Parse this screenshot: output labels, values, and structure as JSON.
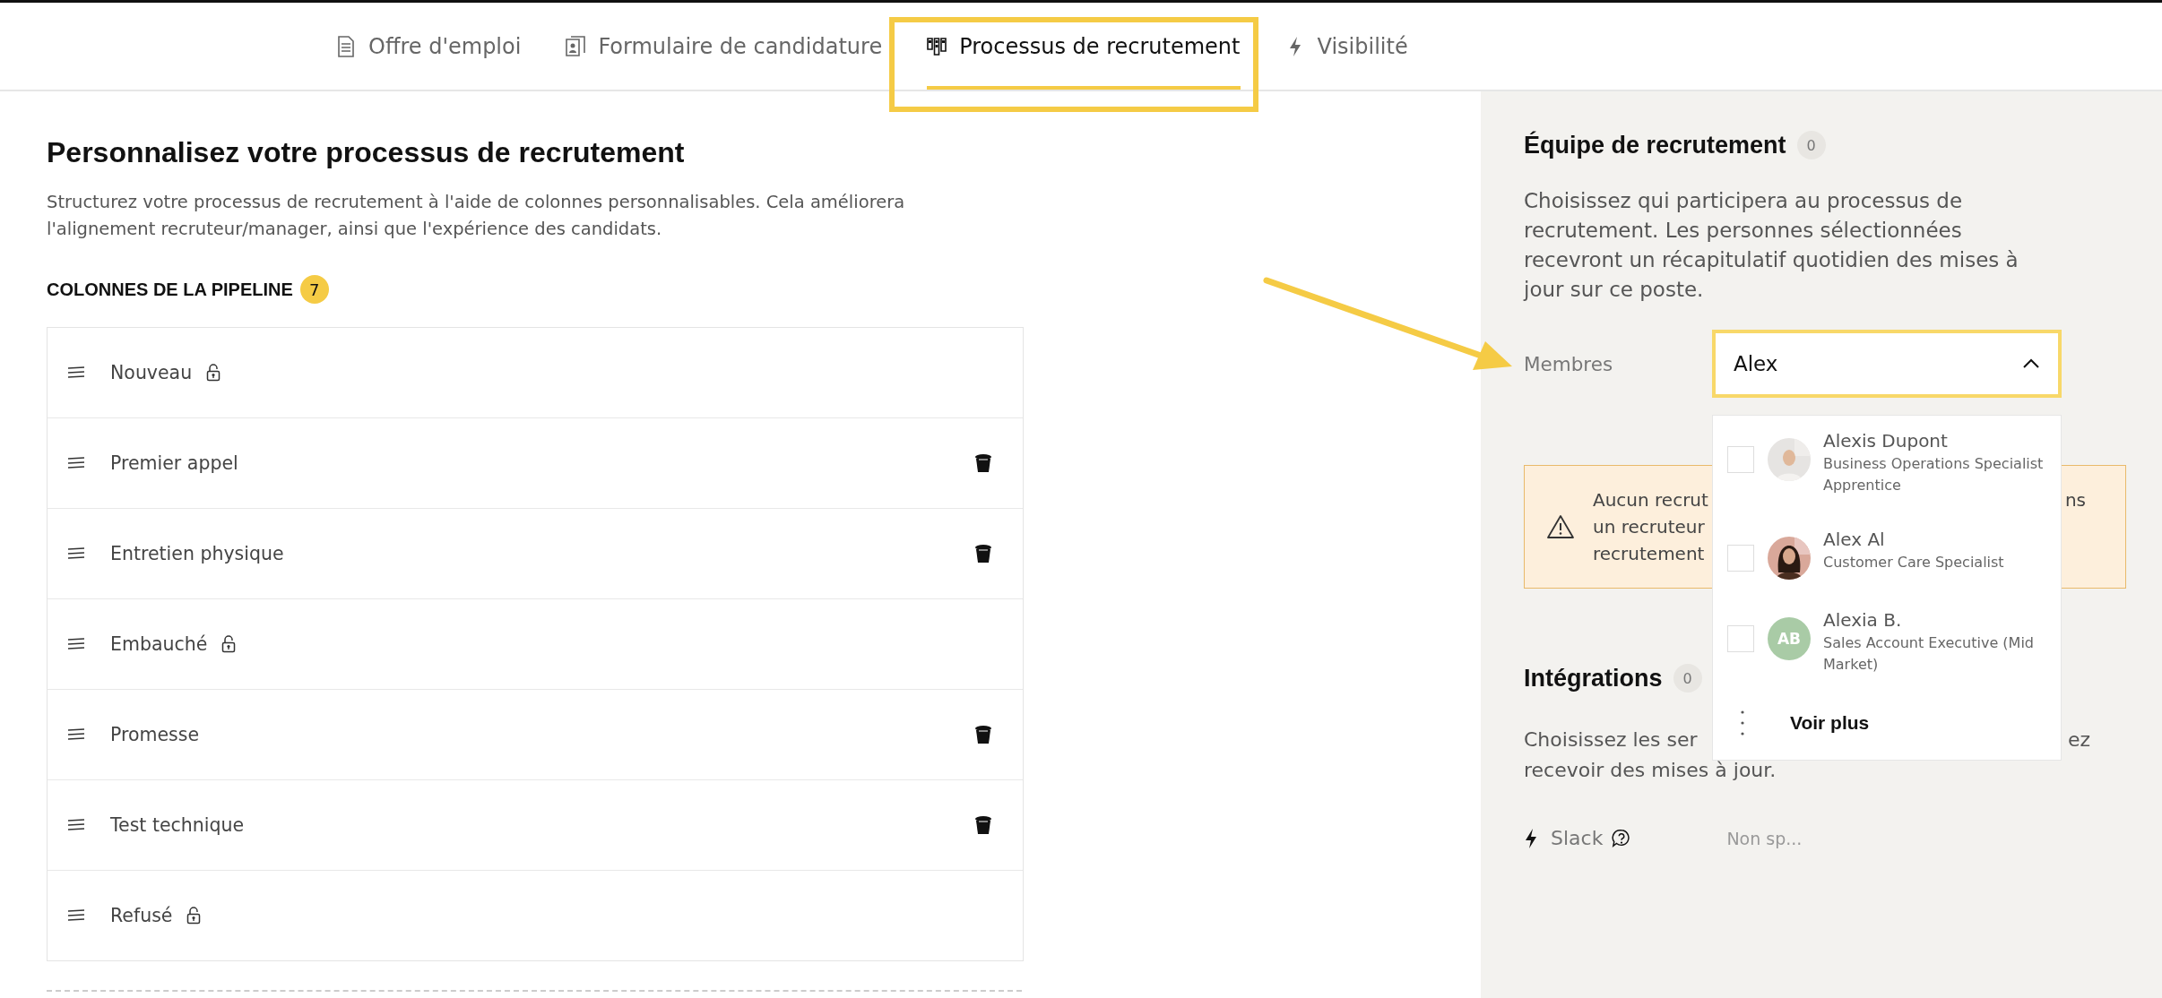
{
  "tabs": [
    {
      "label": "Offre d'emploi",
      "selected": false
    },
    {
      "label": "Formulaire de candidature",
      "selected": false
    },
    {
      "label": "Processus de recrutement",
      "selected": true
    },
    {
      "label": "Visibilité",
      "selected": false
    }
  ],
  "pipeline": {
    "title": "Personnalisez votre processus de recrutement",
    "description": "Structurez votre processus de recrutement à l'aide de colonnes personnalisables. Cela améliorera l'alignement recruteur/manager, ainsi que l'expérience des candidats.",
    "columns_heading": "COLONNES DE LA PIPELINE",
    "count": "7",
    "columns": [
      {
        "name": "Nouveau",
        "locked": true
      },
      {
        "name": "Premier appel",
        "locked": false
      },
      {
        "name": "Entretien physique",
        "locked": false
      },
      {
        "name": "Embauché",
        "locked": true
      },
      {
        "name": "Promesse",
        "locked": false
      },
      {
        "name": "Test technique",
        "locked": false
      },
      {
        "name": "Refusé",
        "locked": true
      }
    ]
  },
  "team": {
    "title": "Équipe de recrutement",
    "count": "0",
    "description": "Choisissez qui participera au processus de recrutement. Les personnes sélectionnées recevront un récapitulatif quotidien des mises à jour sur ce poste.",
    "members_label": "Membres",
    "members_field": {
      "value": "Alex",
      "expanded": true
    },
    "warning": {
      "lines": [
        {
          "left": "Aucun recrut",
          "right": "ns"
        },
        {
          "left": "un recruteur"
        },
        {
          "left": "recrutement"
        }
      ]
    },
    "suggestions": [
      {
        "name": "Alexis Dupont",
        "role": "Business Operations Specialist Apprentice",
        "checked": false
      },
      {
        "name": "Alex Al",
        "role": "Customer Care Specialist",
        "checked": false
      },
      {
        "name": "Alexia B.",
        "role": "Sales Account Executive (Mid Market)",
        "checked": false,
        "avatar": {
          "kind": "initials",
          "initials": "AB",
          "color": "#a9cba6"
        }
      }
    ],
    "more": "Voir plus"
  },
  "integrations": {
    "title": "Intégrations",
    "count": "0",
    "lines": [
      {
        "left": "Choisissez les ser",
        "right": "ez"
      },
      {
        "left": "recevoir des mises à jour."
      }
    ],
    "items": [
      {
        "name": "Slack",
        "value": "Non sp..."
      }
    ]
  }
}
